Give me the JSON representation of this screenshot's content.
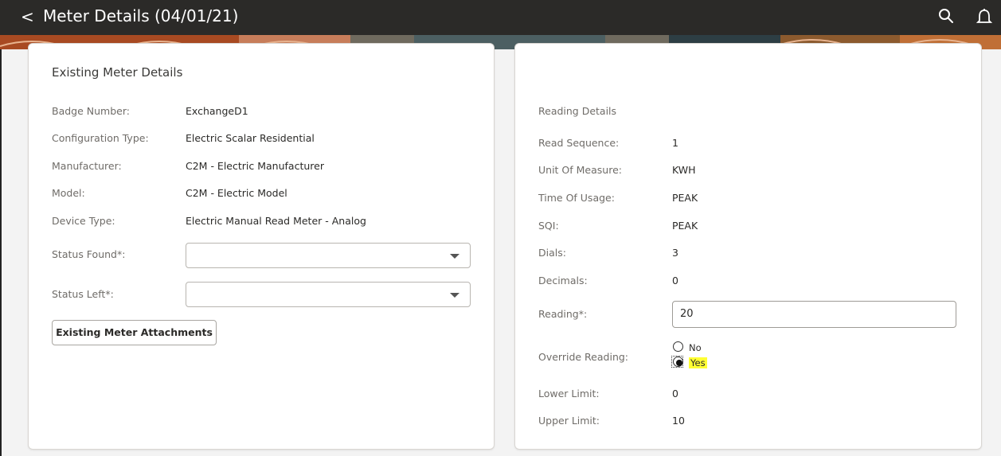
{
  "header": {
    "back_glyph": "<",
    "title": "Meter Details (04/01/21)",
    "icons": [
      "search-icon",
      "bell-icon"
    ]
  },
  "left_card": {
    "title": "Existing Meter Details",
    "fields": [
      {
        "label": "Badge Number:",
        "value": "ExchangeD1"
      },
      {
        "label": "Configuration Type:",
        "value": "Electric Scalar Residential"
      },
      {
        "label": "Manufacturer:",
        "value": "C2M - Electric Manufacturer"
      },
      {
        "label": "Model:",
        "value": "C2M - Electric Model"
      },
      {
        "label": "Device Type:",
        "value": "Electric Manual Read Meter - Analog"
      }
    ],
    "status_found": {
      "label": "Status Found*:",
      "value": ""
    },
    "status_left": {
      "label": "Status Left*:",
      "value": ""
    },
    "attachments_button": "Existing Meter Attachments"
  },
  "right_card": {
    "section_title": "Reading Details",
    "fields": [
      {
        "label": "Read Sequence:",
        "value": "1"
      },
      {
        "label": "Unit Of Measure:",
        "value": "KWH"
      },
      {
        "label": "Time Of Usage:",
        "value": "PEAK"
      },
      {
        "label": "SQI:",
        "value": "PEAK"
      },
      {
        "label": "Dials:",
        "value": "3"
      },
      {
        "label": "Decimals:",
        "value": "0"
      }
    ],
    "reading": {
      "label": "Reading*:",
      "value": "20"
    },
    "override": {
      "label": "Override Reading:",
      "options": [
        "No",
        "Yes"
      ],
      "selected": "Yes"
    },
    "lower_limit": {
      "label": "Lower Limit:",
      "value": "0"
    },
    "upper_limit": {
      "label": "Upper Limit:",
      "value": "10"
    }
  },
  "colors": {
    "header_bg": "#2b2a28",
    "highlight": "#ffff33",
    "banner": "#a84a22"
  }
}
